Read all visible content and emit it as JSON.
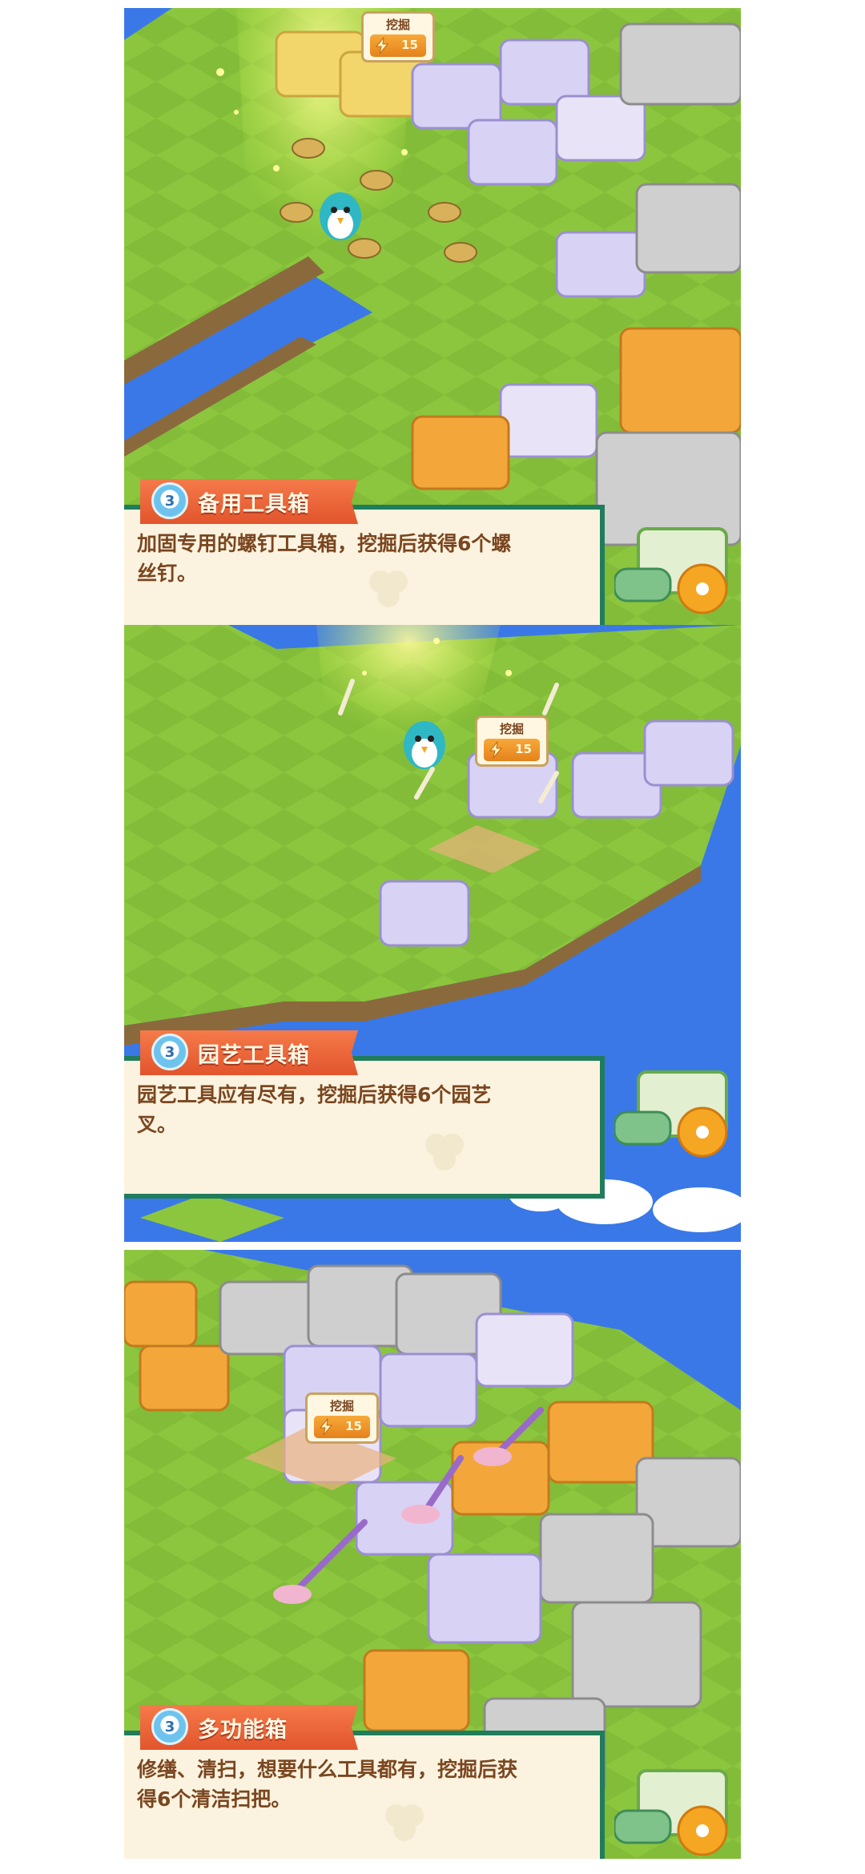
{
  "panels": [
    {
      "dig_tag": {
        "label": "挖掘",
        "cost": "15",
        "icon": "lightning-icon"
      },
      "item": {
        "level": "3",
        "name": "备用工具箱",
        "description": "加固专用的螺钉工具箱，挖掘后获得6个螺\n丝钉。"
      }
    },
    {
      "dig_tag": {
        "label": "挖掘",
        "cost": "15",
        "icon": "lightning-icon"
      },
      "item": {
        "level": "3",
        "name": "园艺工具箱",
        "description": "园艺工具应有尽有，挖掘后获得6个园艺\n叉。"
      }
    },
    {
      "dig_tag": {
        "label": "挖掘",
        "cost": "15",
        "icon": "lightning-icon"
      },
      "item": {
        "level": "3",
        "name": "多功能箱",
        "description": "修缮、清扫，想要什么工具都有，挖掘后获\n得6个清洁扫把。"
      }
    }
  ],
  "colors": {
    "sea": "#3a78e8",
    "grass": "#8cc63e",
    "banner": "#e8603a",
    "dialog_border": "#1f7d5b",
    "dialog_bg": "#fbf3df",
    "text": "#7a4620"
  }
}
